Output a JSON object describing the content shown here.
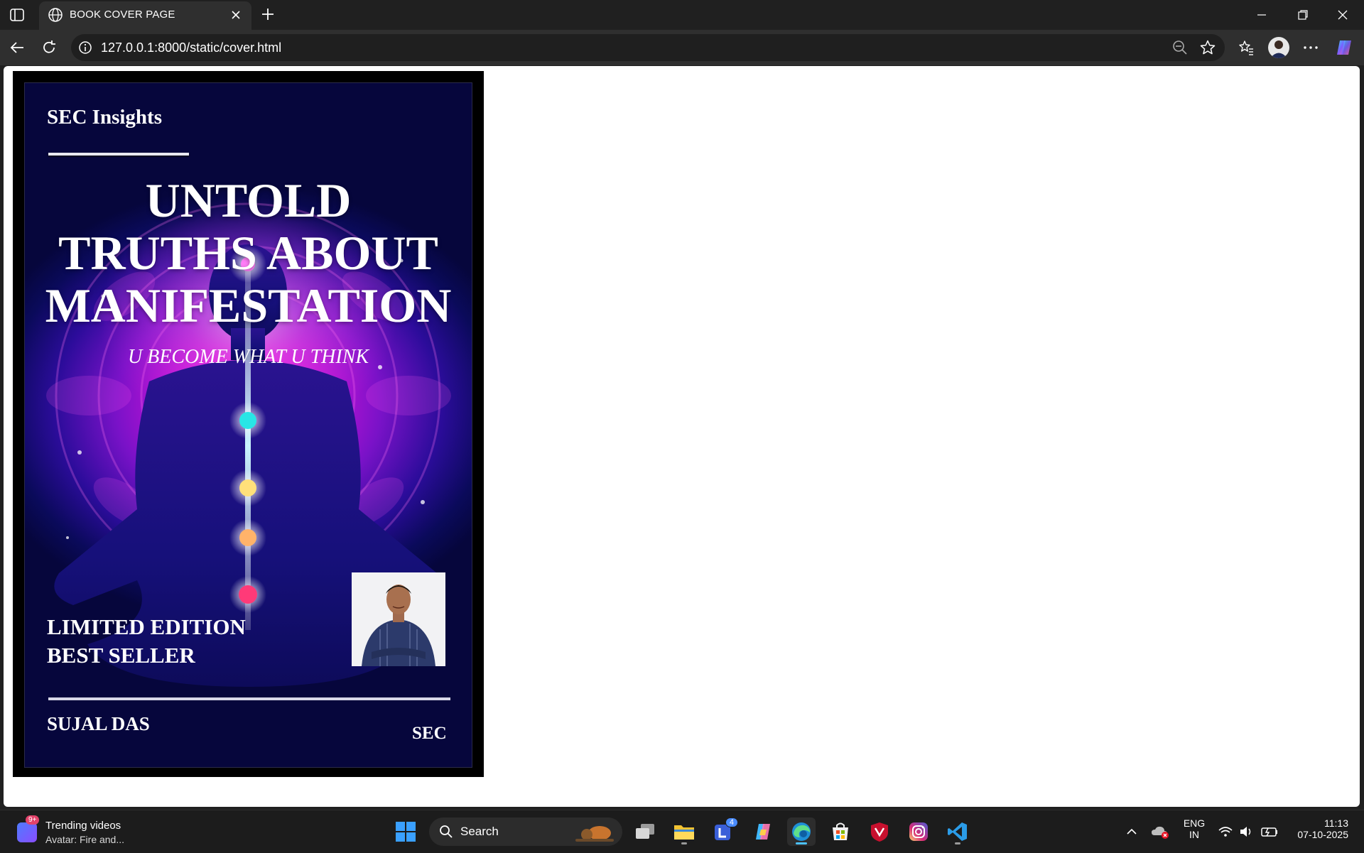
{
  "browser": {
    "tab_title": "BOOK COVER PAGE",
    "url": "127.0.0.1:8000/static/cover.html"
  },
  "cover": {
    "brand": "SEC Insights",
    "title_lines": [
      "UNTOLD",
      "TRUTHS ABOUT",
      "MANIFESTATION"
    ],
    "subtitle": "U BECOME WHAT U THINK",
    "edition_line1": "LIMITED EDITION",
    "edition_line2": "BEST SELLER",
    "author": "SUJAL DAS",
    "publisher": "SEC"
  },
  "taskbar": {
    "widget_badge": "9+",
    "widget_title": "Trending videos",
    "widget_subtitle": "Avatar: Fire and...",
    "search_label": "Search",
    "teams_badge": "4",
    "language_line1": "ENG",
    "language_line2": "IN",
    "time": "11:13",
    "date": "07-10-2025"
  },
  "colors": {
    "accent": "#4cc2ff",
    "cover_magenta": "#ff2bea",
    "cover_navy": "#06063c"
  }
}
